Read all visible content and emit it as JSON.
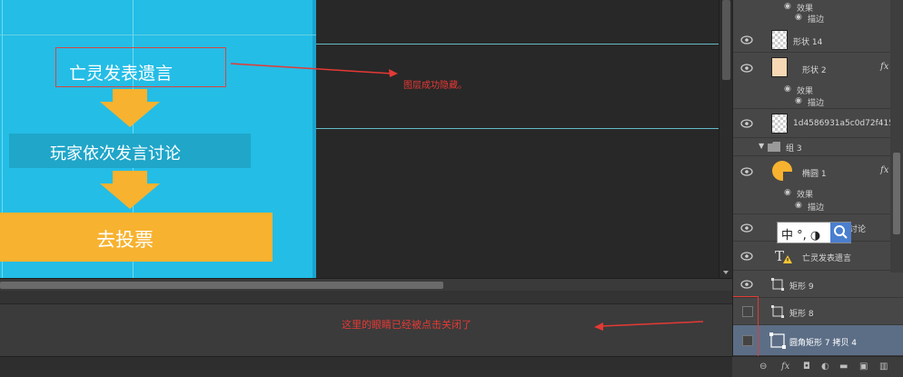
{
  "canvas": {
    "flow": {
      "step1": "亡灵发表遗言",
      "step2": "玩家依次发言讨论",
      "step3": "去投票"
    }
  },
  "annotations": {
    "layer_hidden": "图层成功隐藏。",
    "eye_closed": "这里的眼睛已经被点击关闭了"
  },
  "layers_panel": {
    "effects_label": "效果",
    "stroke_label": "描边",
    "fx_label": "fx",
    "layers": [
      {
        "name": "形状 14"
      },
      {
        "name": "形状 2",
        "fx": true
      },
      {
        "name": "1d4586931a5c0d72f415..."
      },
      {
        "name": "组 3",
        "type": "group"
      },
      {
        "name": "椭圆 1",
        "fx": true
      },
      {
        "name": "讨论",
        "type": "text"
      },
      {
        "name": "亡灵发表遗言",
        "type": "text"
      },
      {
        "name": "矩形 9"
      },
      {
        "name": "矩形 8"
      },
      {
        "name": "圆角矩形 7 拷贝 4"
      }
    ]
  },
  "ime": {
    "text": "中 °, ◑"
  },
  "footer_tools": [
    "link-icon",
    "fx-icon",
    "mask-icon",
    "adjustment-icon",
    "folder-icon",
    "new-layer-icon",
    "trash-icon"
  ],
  "colors": {
    "canvas_bg": "#24bde6",
    "arrow": "#f7b22f",
    "vote_box": "#f7b22f",
    "annotation": "#e53935",
    "selected_layer": "#5c6e86"
  }
}
